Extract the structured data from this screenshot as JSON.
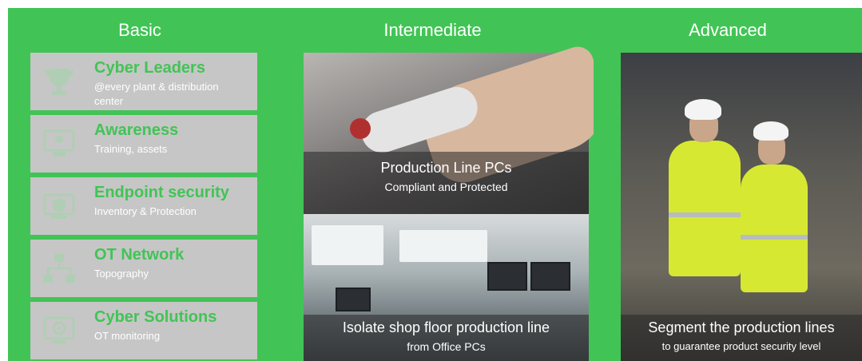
{
  "columns": {
    "basic": {
      "title": "Basic"
    },
    "intermediate": {
      "title": "Intermediate"
    },
    "advanced": {
      "title": "Advanced"
    }
  },
  "basic_items": [
    {
      "title": "Cyber Leaders",
      "subtitle": "@every plant & distribution center",
      "icon": "trophy-icon"
    },
    {
      "title": "Awareness",
      "subtitle": "Training, assets",
      "icon": "training-icon"
    },
    {
      "title": "Endpoint security",
      "subtitle": "Inventory & Protection",
      "icon": "endpoint-icon"
    },
    {
      "title": "OT Network",
      "subtitle": "Topography",
      "icon": "network-icon"
    },
    {
      "title": "Cyber Solutions",
      "subtitle": "OT monitoring",
      "icon": "monitoring-icon"
    }
  ],
  "intermediate": {
    "top_caption": {
      "main": "Production Line PCs",
      "sub": "Compliant and Protected"
    },
    "bottom_caption": {
      "main": "Isolate shop floor production line",
      "sub": "from Office PCs"
    }
  },
  "advanced": {
    "caption": {
      "main": "Segment the production lines",
      "sub": "to guarantee product security level"
    }
  },
  "colors": {
    "accent_green": "#41c455",
    "item_gray": "#c6c6c6",
    "text_white": "#ffffff"
  }
}
